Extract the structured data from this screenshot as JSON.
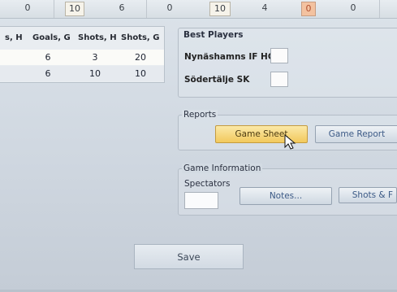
{
  "top_row": {
    "values": [
      "0",
      "10",
      "6",
      "0",
      "10",
      "4",
      "0",
      "0"
    ]
  },
  "stats_table": {
    "headers": [
      "s, H",
      "Goals, G",
      "Shots, H",
      "Shots, G"
    ],
    "rows": [
      [
        "",
        "6",
        "3",
        "20"
      ],
      [
        "",
        "6",
        "10",
        "10"
      ]
    ]
  },
  "best_players": {
    "title": "Best Players",
    "teams": [
      "Nynäshamns IF HC",
      "Södertälje SK"
    ]
  },
  "reports": {
    "title": "Reports",
    "game_sheet": "Game Sheet",
    "game_report": "Game Report"
  },
  "game_information": {
    "title": "Game Information",
    "spectators_label": "Spectators",
    "spectators_value": "",
    "notes_button": "Notes...",
    "shots_button": "Shots & F"
  },
  "save_button": "Save"
}
